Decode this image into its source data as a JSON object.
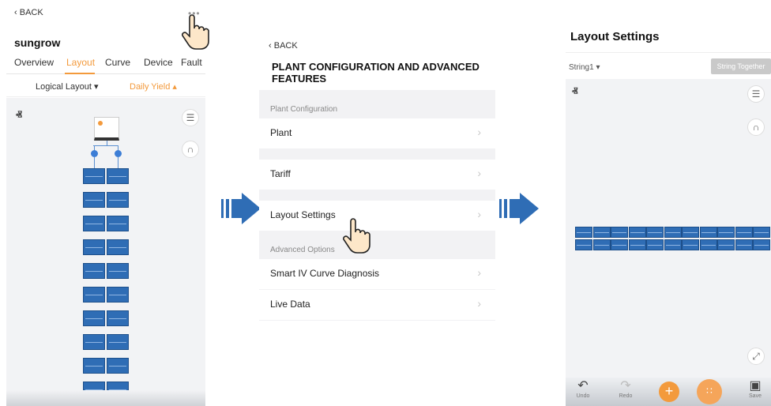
{
  "screen1": {
    "back_label": "BACK",
    "more_label": "•••",
    "title": "sungrow",
    "tabs": [
      "Overview",
      "Layout",
      "Curve",
      "Device",
      "Fault"
    ],
    "active_tab": "Layout",
    "filter_left": "Logical Layout ▾",
    "filter_right": "Daily Yield ▴",
    "accent_color": "#f39a3c"
  },
  "screen2": {
    "back_label": "BACK",
    "title": "PLANT CONFIGURATION AND ADVANCED FEATURES",
    "section_config": "Plant Configuration",
    "section_advanced": "Advanced Options",
    "items": [
      {
        "label": "Plant"
      },
      {
        "label": "Tariff"
      },
      {
        "label": "Layout Settings"
      },
      {
        "label": "Smart IV Curve Diagnosis"
      },
      {
        "label": "Live Data"
      }
    ]
  },
  "screen3": {
    "title": "Layout Settings",
    "string_selector": "String1 ▾",
    "string_together_label": "String Together",
    "bottom_bar": {
      "undo": "Undo",
      "redo": "Redo",
      "save": "Save"
    }
  },
  "icons": {
    "north": "north-arrow-icon",
    "list": "list-icon",
    "curve": "curve-icon",
    "fullscreen": "fullscreen-icon",
    "hand": "hand-pointer-icon",
    "arrow": "flow-arrow-icon"
  },
  "colors": {
    "panel_blue": "#2f6db5",
    "accent_orange": "#f39a3c",
    "arrow_blue": "#2f6db5"
  }
}
